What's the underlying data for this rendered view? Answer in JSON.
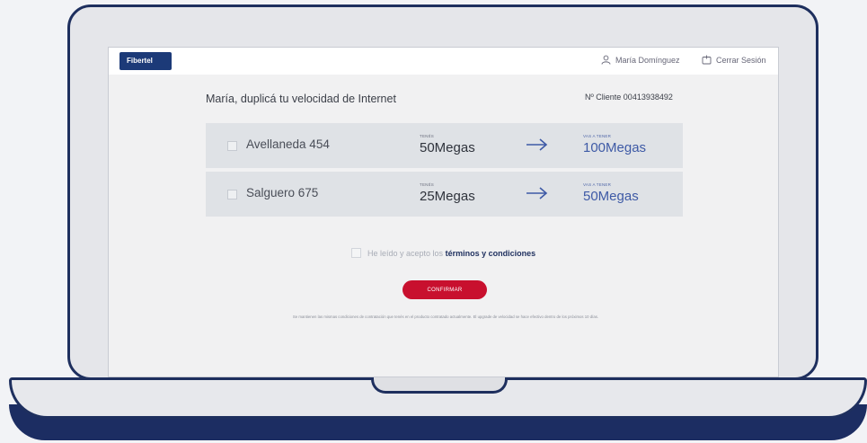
{
  "header": {
    "logo": "Fibertel",
    "user_name": "María Domínguez",
    "logout_label": "Cerrar Sesión"
  },
  "main": {
    "title": "María, duplicá tu velocidad de Internet",
    "client_number": "Nº Cliente 00413938492",
    "rows": [
      {
        "address": "Avellaneda 454",
        "current_label": "TENÉS",
        "current_speed": "50Megas",
        "new_label": "VAS A TENER",
        "new_speed": "100Megas",
        "checked": false
      },
      {
        "address": "Salguero 675",
        "current_label": "TENÉS",
        "current_speed": "25Megas",
        "new_label": "VAS A TENER",
        "new_speed": "50Megas",
        "checked": false
      }
    ],
    "terms_prefix": "He leído y acepto los",
    "terms_link": "términos y condiciones",
    "confirm_label": "CONFIRMAR",
    "disclaimer": "Se mantienen las mismas condiciones de contratación que tenés en el producto contratado actualmente. El upgrade de velocidad se hace efectivo dentro de los próximos 10 días."
  },
  "colors": {
    "brand_navy": "#1e2f5e",
    "accent_blue": "#3e5aa6",
    "confirm_red": "#c8102e",
    "row_background": "#dfe2e6"
  },
  "icons": {
    "user": "user-icon",
    "logout": "logout-icon",
    "arrow": "arrow-right-icon"
  }
}
